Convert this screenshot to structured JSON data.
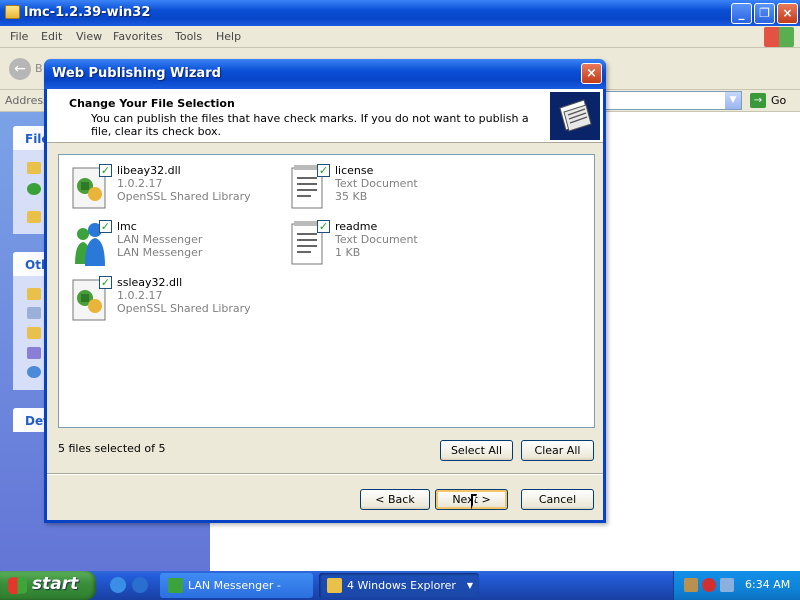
{
  "explorer": {
    "title": "lmc-1.2.39-win32",
    "menu": [
      "File",
      "Edit",
      "View",
      "Favorites",
      "Tools",
      "Help"
    ],
    "back_label": "B",
    "address_label": "Address",
    "go_label": "Go",
    "taskpane_heads": [
      "File",
      "Oth",
      "Det"
    ]
  },
  "dialog": {
    "title": "Web Publishing Wizard",
    "heading": "Change Your File Selection",
    "subtext": "You can publish the files that have check marks.  If you do not want to publish a file, clear its check box.",
    "files": [
      {
        "name": "libeay32.dll",
        "line2": "1.0.2.17",
        "line3": "OpenSSL Shared Library",
        "icon": "dll-icon",
        "checked": true
      },
      {
        "name": "license",
        "line2": "Text Document",
        "line3": "35 KB",
        "icon": "text-document-icon",
        "checked": true
      },
      {
        "name": "lmc",
        "line2": "LAN Messenger",
        "line3": "LAN Messenger",
        "icon": "lan-messenger-icon",
        "checked": true
      },
      {
        "name": "readme",
        "line2": "Text Document",
        "line3": "1 KB",
        "icon": "text-document-icon",
        "checked": true
      },
      {
        "name": "ssleay32.dll",
        "line2": "1.0.2.17",
        "line3": "OpenSSL Shared Library",
        "icon": "dll-icon",
        "checked": true
      }
    ],
    "selection_status": "5 files selected of 5",
    "select_all_label": "Select All",
    "clear_all_label": "Clear All",
    "back_label": "< Back",
    "next_label": "Next >",
    "cancel_label": "Cancel"
  },
  "taskbar": {
    "start_label": "start",
    "tasks": [
      {
        "label": "LAN Messenger - free...",
        "active": false
      },
      {
        "label": "4 Windows Explorer",
        "active": true
      }
    ],
    "clock": "6:34 AM"
  },
  "colors": {
    "titlebar": "#0a4fd6",
    "taskbar": "#245edb",
    "start": "#3c8f3c",
    "tray": "#0f84d8",
    "check": "#21a121"
  }
}
